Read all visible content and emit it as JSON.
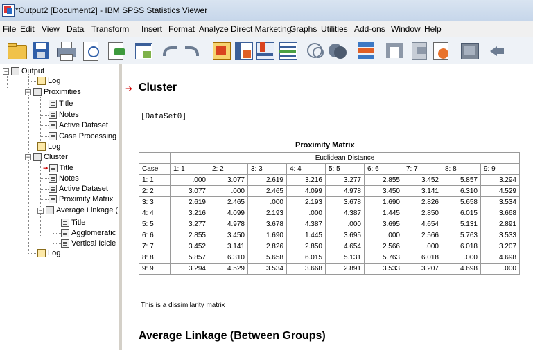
{
  "window": {
    "title": "*Output2 [Document2] - IBM SPSS Statistics Viewer"
  },
  "menu": [
    "File",
    "Edit",
    "View",
    "Data",
    "Transform",
    "Insert",
    "Format",
    "Analyze",
    "Direct Marketing",
    "Graphs",
    "Utilities",
    "Add-ons",
    "Window",
    "Help"
  ],
  "toolbar_icons": [
    "open-icon",
    "save-icon",
    "print-icon",
    "print-preview-icon",
    "export-icon",
    "goto-data-icon",
    "undo-icon",
    "redo-icon",
    "goto-case-icon",
    "goto-variable-icon",
    "insert-chart-icon",
    "insert-table-icon",
    "select-cases-icon",
    "weight-cases-icon",
    "split-file-icon",
    "value-labels-icon",
    "use-sets-icon",
    "show-all-icon",
    "designate-window-icon",
    "back-icon"
  ],
  "outline": {
    "root": "Output",
    "log1": "Log",
    "proximities": "Proximities",
    "p_title": "Title",
    "p_notes": "Notes",
    "p_active": "Active Dataset",
    "p_case": "Case Processing",
    "log2": "Log",
    "cluster": "Cluster",
    "c_title": "Title",
    "c_notes": "Notes",
    "c_active": "Active Dataset",
    "c_prox": "Proximity Matrix",
    "c_avg": "Average Linkage (",
    "a_title": "Title",
    "a_agglom": "Agglomeratic",
    "a_icicle": "Vertical Icicle",
    "log3": "Log"
  },
  "content": {
    "heading": "Cluster",
    "dataset": "[DataSet0]",
    "table_title": "Proximity Matrix",
    "group_header": "Euclidean Distance",
    "case_header": "Case",
    "columns": [
      "1:   1",
      "2:   2",
      "3:   3",
      "4:   4",
      "5:   5",
      "6:   6",
      "7:   7",
      "8:   8",
      "9:   9"
    ],
    "rows": [
      {
        "label": "1:   1",
        "values": [
          ".000",
          "3.077",
          "2.619",
          "3.216",
          "3.277",
          "2.855",
          "3.452",
          "5.857",
          "3.294"
        ]
      },
      {
        "label": "2:   2",
        "values": [
          "3.077",
          ".000",
          "2.465",
          "4.099",
          "4.978",
          "3.450",
          "3.141",
          "6.310",
          "4.529"
        ]
      },
      {
        "label": "3:   3",
        "values": [
          "2.619",
          "2.465",
          ".000",
          "2.193",
          "3.678",
          "1.690",
          "2.826",
          "5.658",
          "3.534"
        ]
      },
      {
        "label": "4:   4",
        "values": [
          "3.216",
          "4.099",
          "2.193",
          ".000",
          "4.387",
          "1.445",
          "2.850",
          "6.015",
          "3.668"
        ]
      },
      {
        "label": "5:   5",
        "values": [
          "3.277",
          "4.978",
          "3.678",
          "4.387",
          ".000",
          "3.695",
          "4.654",
          "5.131",
          "2.891"
        ]
      },
      {
        "label": "6:   6",
        "values": [
          "2.855",
          "3.450",
          "1.690",
          "1.445",
          "3.695",
          ".000",
          "2.566",
          "5.763",
          "3.533"
        ]
      },
      {
        "label": "7:   7",
        "values": [
          "3.452",
          "3.141",
          "2.826",
          "2.850",
          "4.654",
          "2.566",
          ".000",
          "6.018",
          "3.207"
        ]
      },
      {
        "label": "8:   8",
        "values": [
          "5.857",
          "6.310",
          "5.658",
          "6.015",
          "5.131",
          "5.763",
          "6.018",
          ".000",
          "4.698"
        ]
      },
      {
        "label": "9:   9",
        "values": [
          "3.294",
          "4.529",
          "3.534",
          "3.668",
          "2.891",
          "3.533",
          "3.207",
          "4.698",
          ".000"
        ]
      }
    ],
    "footnote": "This is a dissimilarity matrix",
    "heading2": "Average Linkage (Between Groups)"
  }
}
